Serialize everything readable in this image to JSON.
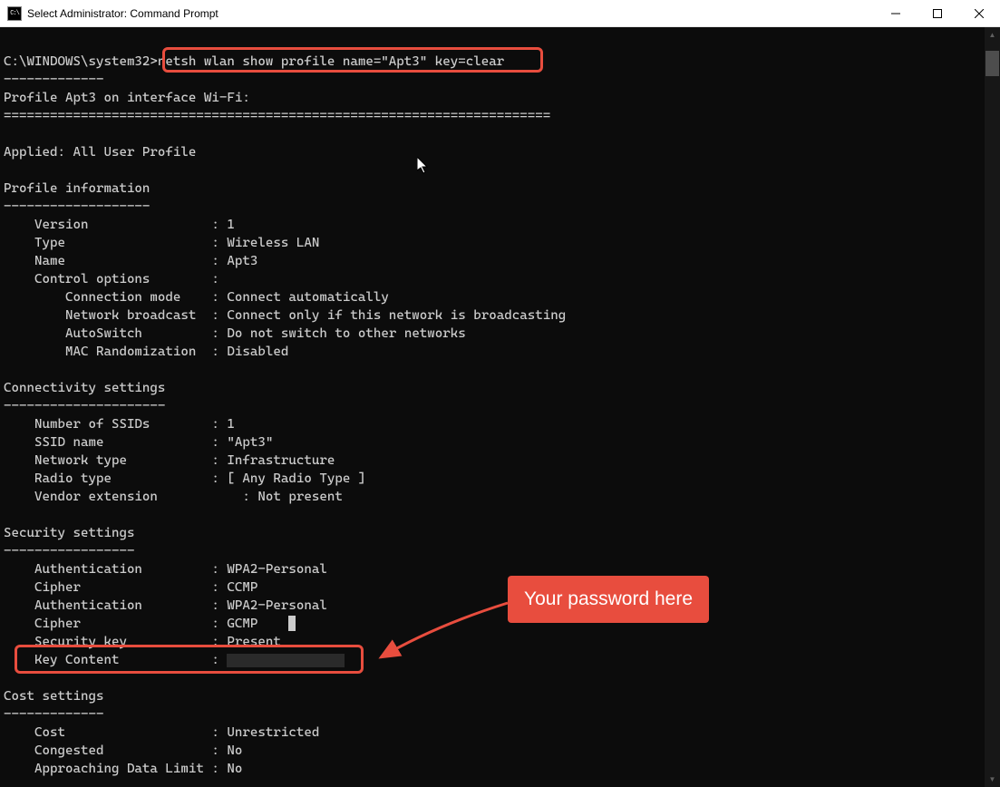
{
  "title": "Select Administrator: Command Prompt",
  "prompt_prefix": "C:\\WINDOWS\\system32>",
  "command": "netsh wlan show profile name=\"Apt3\" key=clear",
  "heading": "Profile Apt3 on interface Wi-Fi:",
  "applied": "Applied: All User Profile",
  "section_profile": "Profile information",
  "profile": {
    "version": {
      "label": "Version",
      "value": "1"
    },
    "type": {
      "label": "Type",
      "value": "Wireless LAN"
    },
    "name": {
      "label": "Name",
      "value": "Apt3"
    },
    "control": {
      "label": "Control options",
      "value": ""
    },
    "conn_mode": {
      "label": "Connection mode",
      "value": "Connect automatically"
    },
    "net_broadcast": {
      "label": "Network broadcast",
      "value": "Connect only if this network is broadcasting"
    },
    "autoswitch": {
      "label": "AutoSwitch",
      "value": "Do not switch to other networks"
    },
    "mac_rand": {
      "label": "MAC Randomization",
      "value": "Disabled"
    }
  },
  "section_conn": "Connectivity settings",
  "conn": {
    "num_ssids": {
      "label": "Number of SSIDs",
      "value": "1"
    },
    "ssid_name": {
      "label": "SSID name",
      "value": "\"Apt3\""
    },
    "net_type": {
      "label": "Network type",
      "value": "Infrastructure"
    },
    "radio_type": {
      "label": "Radio type",
      "value": "[ Any Radio Type ]"
    },
    "vendor_ext": {
      "label": "Vendor extension",
      "value": "Not present"
    }
  },
  "section_sec": "Security settings",
  "sec": {
    "auth1": {
      "label": "Authentication",
      "value": "WPA2-Personal"
    },
    "cipher1": {
      "label": "Cipher",
      "value": "CCMP"
    },
    "auth2": {
      "label": "Authentication",
      "value": "WPA2-Personal"
    },
    "cipher2": {
      "label": "Cipher",
      "value": "GCMP"
    },
    "sec_key": {
      "label": "Security key",
      "value": "Present"
    },
    "key_content": {
      "label": "Key Content",
      "value": ""
    }
  },
  "section_cost": "Cost settings",
  "cost": {
    "cost": {
      "label": "Cost",
      "value": "Unrestricted"
    },
    "congested": {
      "label": "Congested",
      "value": "No"
    },
    "approaching": {
      "label": "Approaching Data Limit",
      "value": "No"
    }
  },
  "callout": "Your password here"
}
